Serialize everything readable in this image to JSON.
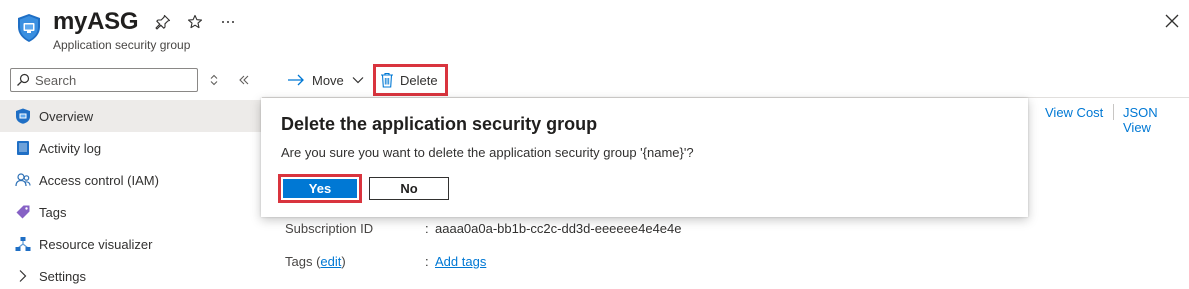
{
  "header": {
    "title": "myASG",
    "subtitle": "Application security group",
    "icons": [
      "asg-shield-icon",
      "pin-icon",
      "star-icon",
      "more-icon",
      "close-icon"
    ]
  },
  "sidebar": {
    "search_placeholder": "Search",
    "items": [
      {
        "label": "Overview",
        "icon": "overview-icon",
        "active": true
      },
      {
        "label": "Activity log",
        "icon": "activity-log-icon"
      },
      {
        "label": "Access control (IAM)",
        "icon": "iam-icon"
      },
      {
        "label": "Tags",
        "icon": "tag-icon"
      },
      {
        "label": "Resource visualizer",
        "icon": "visualizer-icon"
      },
      {
        "label": "Settings",
        "icon": "chevron-right-icon"
      }
    ]
  },
  "toolbar": {
    "move_label": "Move",
    "delete_label": "Delete"
  },
  "links": {
    "view_cost": "View Cost",
    "json_view": "JSON View"
  },
  "essentials": {
    "subscription_label": "Subscription ID",
    "subscription_value": "aaaa0a0a-bb1b-cc2c-dd3d-eeeeee4e4e4e",
    "tags_label_prefix": "Tags (",
    "tags_edit": "edit",
    "tags_label_suffix": ")",
    "tags_value": "Add tags",
    "colon": ":"
  },
  "dialog": {
    "title": "Delete the application security group",
    "message": "Are you sure you want to delete the application security group '{name}'?",
    "yes_label": "Yes",
    "no_label": "No"
  },
  "colors": {
    "accent": "#0078d4",
    "highlight": "#d9343e",
    "nav_active": "#edebe9"
  }
}
